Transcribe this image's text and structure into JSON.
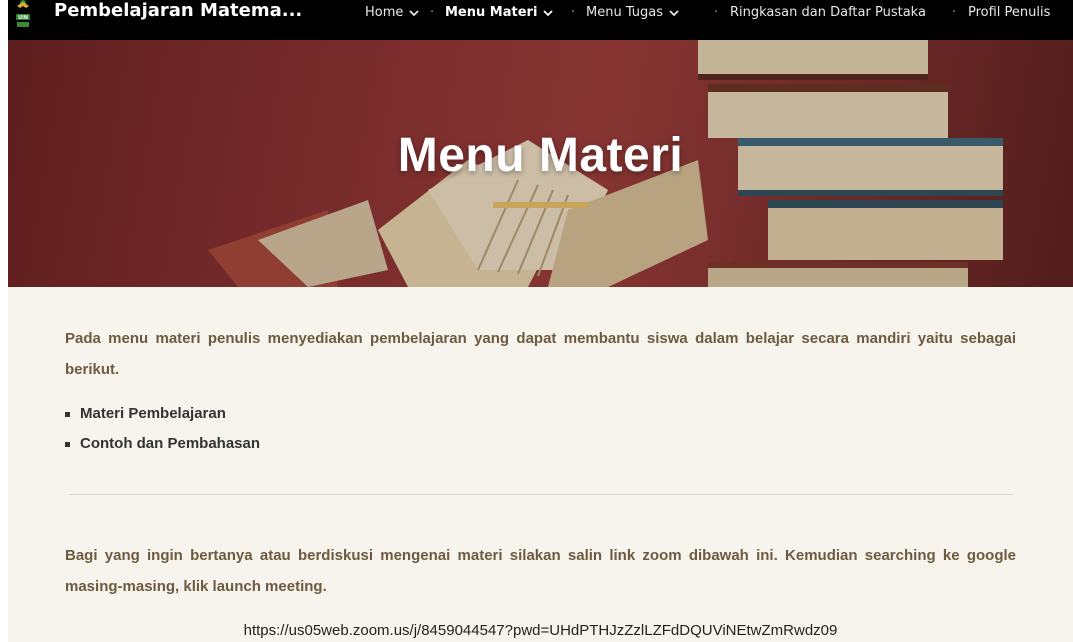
{
  "header": {
    "site_title": "Pembelajaran Matema...",
    "nav": [
      {
        "label": "Home"
      },
      {
        "label": "Menu Materi"
      },
      {
        "label": "Menu Tugas"
      },
      {
        "label": "Ringkasan dan Daftar Pustaka"
      },
      {
        "label": "Profil Penulis"
      }
    ]
  },
  "hero": {
    "title": "Menu Materi"
  },
  "main": {
    "intro": "Pada menu materi penulis menyediakan pembelajaran yang dapat membantu siswa dalam belajar secara mandiri yaitu sebagai berikut.",
    "items": [
      "Materi Pembelajaran",
      "Contoh dan Pembahasan"
    ],
    "discussion": "Bagi yang ingin bertanya atau berdiskusi mengenai materi silakan salin link zoom dibawah ini.  Kemudian searching ke google masing-masing, klik launch meeting.",
    "zoom_link": "https://us05web.zoom.us/j/8459044547?pwd=UHdPTHJzZzlLZFdDQUViNEtwZmRwdz09"
  },
  "colors": {
    "accent": "#caa45a",
    "body_text": "#6e5a3f",
    "background": "#f7f4ed"
  }
}
